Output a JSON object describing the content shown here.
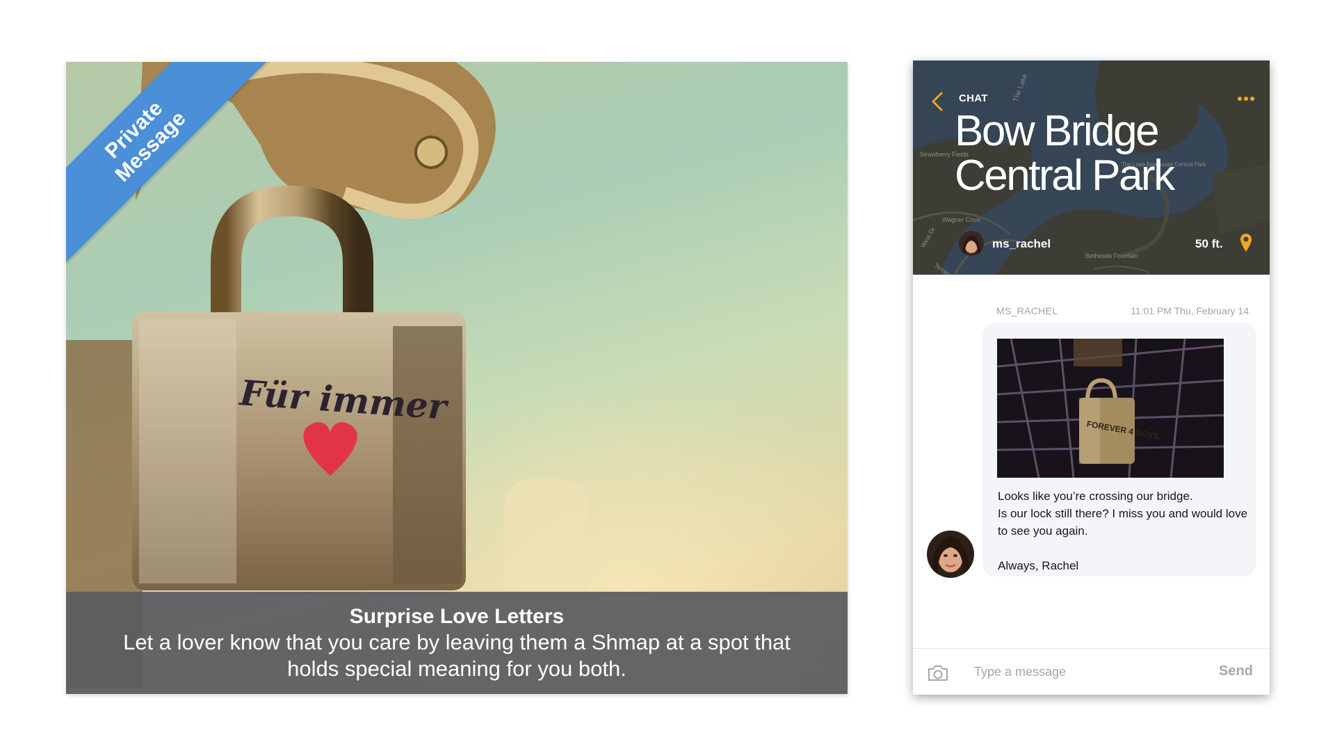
{
  "promo": {
    "ribbon_line1": "Private",
    "ribbon_line2": "Message",
    "title": "Surprise Love Letters",
    "body": "Let a lover know that you care by leaving them a Shmap at a spot that holds special meaning for you both.",
    "lock_engraving": "Für immer",
    "colors": {
      "ribbon": "#4a8fd8",
      "caption_bg": "#5a5a60"
    }
  },
  "chat": {
    "header_label": "CHAT",
    "place_line1": "Bow Bridge",
    "place_line2": "Central Park",
    "username": "ms_rachel",
    "distance": "50 ft.",
    "map_labels": [
      "The Lake",
      "Strawberry Fields",
      "Wagner Cove",
      "The Loeb Boathouse Central Park",
      "Bethesda Fountain",
      "West Dr",
      "Terrace Dr"
    ],
    "icons": {
      "back": "chevron-left-icon",
      "more": "more-dots-icon",
      "pin": "location-pin-icon",
      "camera": "camera-icon"
    },
    "accent_color": "#f5a623",
    "message": {
      "sender": "MS_RACHEL",
      "timestamp": "11:01 PM Thu, February 14",
      "text": "Looks like you’re crossing our bridge.\nIs our lock still there? I miss you and would love to see you again.\n\nAlways, Rachel",
      "photo_engraving": "FOREVER 4 BOYS"
    },
    "composer": {
      "placeholder": "Type a message",
      "send_label": "Send"
    }
  }
}
